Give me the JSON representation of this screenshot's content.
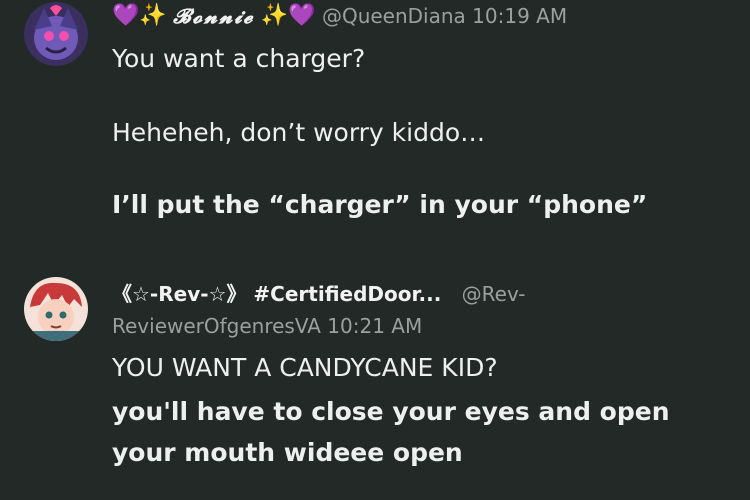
{
  "colors": {
    "background": "#232927",
    "text": "#eef0ef",
    "meta": "#9aa09e",
    "heart": "#a24fe8",
    "sparkle": "#ffd23f"
  },
  "posts": [
    {
      "author": {
        "prefix_emoji": "💜✨",
        "display_name": "𝓑𝓸𝓷𝓷𝓲𝓮",
        "suffix_emoji": "✨💜",
        "handle": "@QueenDiana",
        "time": "10:19 AM"
      },
      "lines": [
        "You want a charger?",
        "Heheheh, don’t worry kiddo…",
        "I’ll put the “charger” in your “phone”"
      ]
    },
    {
      "author": {
        "display_name": "《☆-Rev-☆》 #CertifiedDoor...",
        "handle_part1": "@Rev-",
        "handle_part2": "ReviewerOfgenresVA",
        "time": "10:21 AM"
      },
      "lines": [
        "YOU WANT A CANDYCANE KID?",
        "you'll have to close your eyes and open",
        "your mouth wideee open"
      ]
    }
  ]
}
